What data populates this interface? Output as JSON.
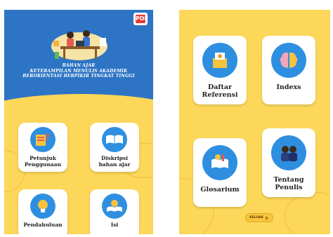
{
  "left_screen": {
    "pdf_badge": "PDF",
    "title_lines": [
      "BAHAN AJAR",
      "KETERAMPILAN MENULIS AKADEMIK",
      "BERORIENTASI BERPIKIR TINGKAT TINGGI"
    ],
    "menu": [
      {
        "label": "Petunjuk\nPenggunaan",
        "icon": "guide-book-icon"
      },
      {
        "label": "Diskripsi\nbahan ajar",
        "icon": "open-book-icon"
      },
      {
        "label": "Pendahuluan",
        "icon": "lightbulb-icon"
      },
      {
        "label": "Isi",
        "icon": "reading-book-icon"
      }
    ]
  },
  "right_screen": {
    "menu": [
      {
        "label": "Daftar\nReferensi",
        "icon": "reference-box-icon"
      },
      {
        "label": "Indexs",
        "icon": "brain-icon"
      },
      {
        "label": "Glosarium",
        "icon": "glossary-book-icon"
      },
      {
        "label": "Tentang\nPenulis",
        "icon": "authors-icon"
      }
    ],
    "exit_label": "KELUAR"
  },
  "colors": {
    "background_yellow": "#fcd75a",
    "header_blue": "#2d74c4",
    "icon_circle_blue": "#2e8fe0",
    "card_white": "#ffffff"
  }
}
